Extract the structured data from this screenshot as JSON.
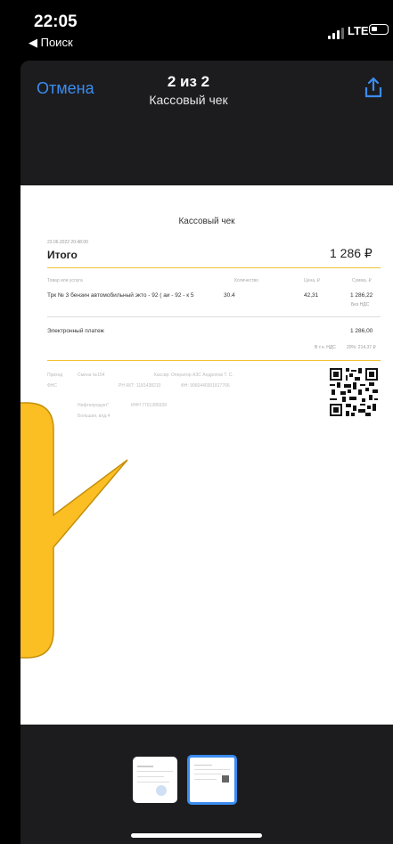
{
  "status_bar": {
    "time": "22:05",
    "back_label": "◀ Поиск",
    "network": "LTE"
  },
  "nav": {
    "cancel": "Отмена",
    "page_counter": "2 из 2",
    "title": "Кассовый чек",
    "share_icon": "share-icon"
  },
  "receipt": {
    "title": "Кассовый чек",
    "date": "23.06.2022 20:48:00",
    "total_label": "Итого",
    "total_value": "1 286 ₽",
    "columns": {
      "item": "Товар или услуга",
      "qty": "Количество",
      "price": "Цена, ₽",
      "sum": "Сумма, ₽"
    },
    "item": {
      "name": "Трк № 3 бензин автомобильный экто - 92 ( аи - 92 - к 5",
      "qty": "30.4",
      "price": "42,31",
      "sum": "1 286,22",
      "vat": "Без НДС"
    },
    "payment_label": "Электронный платеж",
    "payment_value": "1 286,00",
    "vat_label": "В т.ч. НДС",
    "vat_value": "20%: 214,37 ₽",
    "footer": {
      "line1_a": "Приход",
      "line1_b": "Смена №154",
      "line1_c": "Кассир: Оператор АЗС Андропов Т. С.",
      "line2_a": "ФНС",
      "line2_b": "РН ККТ: 1181438210",
      "line2_c": "ФН: 9960440301817766",
      "line3_a": "Нефтепродукт\"",
      "line3_b": "ИНН 7701285928",
      "line4": "Большая, влд.4"
    }
  },
  "thumbnails": [
    {
      "label": "page-1"
    },
    {
      "label": "page-2",
      "selected": true
    }
  ],
  "colors": {
    "accent": "#3b8cf0",
    "bubble": "#fbbf24",
    "receipt_line": "#f1c232"
  }
}
